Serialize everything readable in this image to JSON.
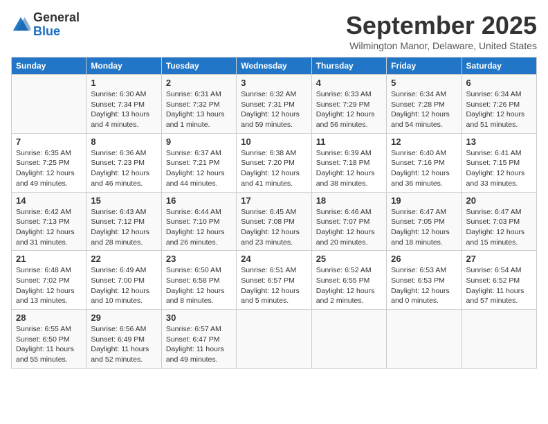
{
  "logo": {
    "general": "General",
    "blue": "Blue"
  },
  "header": {
    "month": "September 2025",
    "location": "Wilmington Manor, Delaware, United States"
  },
  "days_of_week": [
    "Sunday",
    "Monday",
    "Tuesday",
    "Wednesday",
    "Thursday",
    "Friday",
    "Saturday"
  ],
  "weeks": [
    [
      {
        "day": "",
        "info": ""
      },
      {
        "day": "1",
        "info": "Sunrise: 6:30 AM\nSunset: 7:34 PM\nDaylight: 13 hours\nand 4 minutes."
      },
      {
        "day": "2",
        "info": "Sunrise: 6:31 AM\nSunset: 7:32 PM\nDaylight: 13 hours\nand 1 minute."
      },
      {
        "day": "3",
        "info": "Sunrise: 6:32 AM\nSunset: 7:31 PM\nDaylight: 12 hours\nand 59 minutes."
      },
      {
        "day": "4",
        "info": "Sunrise: 6:33 AM\nSunset: 7:29 PM\nDaylight: 12 hours\nand 56 minutes."
      },
      {
        "day": "5",
        "info": "Sunrise: 6:34 AM\nSunset: 7:28 PM\nDaylight: 12 hours\nand 54 minutes."
      },
      {
        "day": "6",
        "info": "Sunrise: 6:34 AM\nSunset: 7:26 PM\nDaylight: 12 hours\nand 51 minutes."
      }
    ],
    [
      {
        "day": "7",
        "info": "Sunrise: 6:35 AM\nSunset: 7:25 PM\nDaylight: 12 hours\nand 49 minutes."
      },
      {
        "day": "8",
        "info": "Sunrise: 6:36 AM\nSunset: 7:23 PM\nDaylight: 12 hours\nand 46 minutes."
      },
      {
        "day": "9",
        "info": "Sunrise: 6:37 AM\nSunset: 7:21 PM\nDaylight: 12 hours\nand 44 minutes."
      },
      {
        "day": "10",
        "info": "Sunrise: 6:38 AM\nSunset: 7:20 PM\nDaylight: 12 hours\nand 41 minutes."
      },
      {
        "day": "11",
        "info": "Sunrise: 6:39 AM\nSunset: 7:18 PM\nDaylight: 12 hours\nand 38 minutes."
      },
      {
        "day": "12",
        "info": "Sunrise: 6:40 AM\nSunset: 7:16 PM\nDaylight: 12 hours\nand 36 minutes."
      },
      {
        "day": "13",
        "info": "Sunrise: 6:41 AM\nSunset: 7:15 PM\nDaylight: 12 hours\nand 33 minutes."
      }
    ],
    [
      {
        "day": "14",
        "info": "Sunrise: 6:42 AM\nSunset: 7:13 PM\nDaylight: 12 hours\nand 31 minutes."
      },
      {
        "day": "15",
        "info": "Sunrise: 6:43 AM\nSunset: 7:12 PM\nDaylight: 12 hours\nand 28 minutes."
      },
      {
        "day": "16",
        "info": "Sunrise: 6:44 AM\nSunset: 7:10 PM\nDaylight: 12 hours\nand 26 minutes."
      },
      {
        "day": "17",
        "info": "Sunrise: 6:45 AM\nSunset: 7:08 PM\nDaylight: 12 hours\nand 23 minutes."
      },
      {
        "day": "18",
        "info": "Sunrise: 6:46 AM\nSunset: 7:07 PM\nDaylight: 12 hours\nand 20 minutes."
      },
      {
        "day": "19",
        "info": "Sunrise: 6:47 AM\nSunset: 7:05 PM\nDaylight: 12 hours\nand 18 minutes."
      },
      {
        "day": "20",
        "info": "Sunrise: 6:47 AM\nSunset: 7:03 PM\nDaylight: 12 hours\nand 15 minutes."
      }
    ],
    [
      {
        "day": "21",
        "info": "Sunrise: 6:48 AM\nSunset: 7:02 PM\nDaylight: 12 hours\nand 13 minutes."
      },
      {
        "day": "22",
        "info": "Sunrise: 6:49 AM\nSunset: 7:00 PM\nDaylight: 12 hours\nand 10 minutes."
      },
      {
        "day": "23",
        "info": "Sunrise: 6:50 AM\nSunset: 6:58 PM\nDaylight: 12 hours\nand 8 minutes."
      },
      {
        "day": "24",
        "info": "Sunrise: 6:51 AM\nSunset: 6:57 PM\nDaylight: 12 hours\nand 5 minutes."
      },
      {
        "day": "25",
        "info": "Sunrise: 6:52 AM\nSunset: 6:55 PM\nDaylight: 12 hours\nand 2 minutes."
      },
      {
        "day": "26",
        "info": "Sunrise: 6:53 AM\nSunset: 6:53 PM\nDaylight: 12 hours\nand 0 minutes."
      },
      {
        "day": "27",
        "info": "Sunrise: 6:54 AM\nSunset: 6:52 PM\nDaylight: 11 hours\nand 57 minutes."
      }
    ],
    [
      {
        "day": "28",
        "info": "Sunrise: 6:55 AM\nSunset: 6:50 PM\nDaylight: 11 hours\nand 55 minutes."
      },
      {
        "day": "29",
        "info": "Sunrise: 6:56 AM\nSunset: 6:49 PM\nDaylight: 11 hours\nand 52 minutes."
      },
      {
        "day": "30",
        "info": "Sunrise: 6:57 AM\nSunset: 6:47 PM\nDaylight: 11 hours\nand 49 minutes."
      },
      {
        "day": "",
        "info": ""
      },
      {
        "day": "",
        "info": ""
      },
      {
        "day": "",
        "info": ""
      },
      {
        "day": "",
        "info": ""
      }
    ]
  ]
}
